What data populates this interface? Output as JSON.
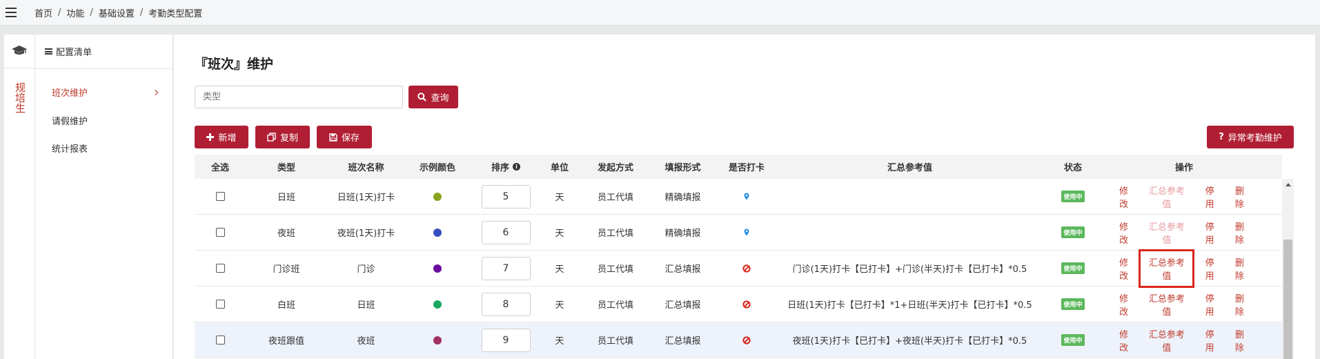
{
  "breadcrumb": [
    "首页",
    "功能",
    "基础设置",
    "考勤类型配置"
  ],
  "module": {
    "label": "规培生"
  },
  "menu": {
    "header": "配置清单",
    "items": [
      {
        "label": "班次维护",
        "active": true
      },
      {
        "label": "请假维护",
        "active": false
      },
      {
        "label": "统计报表",
        "active": false
      }
    ]
  },
  "page": {
    "title": "『班次』维护"
  },
  "search": {
    "placeholder": "类型",
    "button": "查询"
  },
  "toolbar": {
    "add": "新增",
    "copy": "复制",
    "save": "保存",
    "abnormal": "异常考勤维护"
  },
  "table": {
    "headers": {
      "select_all": "全选",
      "type": "类型",
      "shift_name": "班次名称",
      "color": "示例颜色",
      "order": "排序",
      "unit": "单位",
      "initiator": "发起方式",
      "form": "填报形式",
      "punch": "是否打卡",
      "summary": "汇总参考值",
      "status": "状态",
      "ops": "操作"
    },
    "rows": [
      {
        "type": "日班",
        "name": "日班(1天)打卡",
        "color": "#8aa31d",
        "order": "5",
        "unit": "天",
        "initiator": "员工代填",
        "form": "精确填报",
        "punch": "location",
        "summary": "",
        "status": "使用中",
        "ops": [
          "修改",
          "汇总参考值",
          "停用",
          "删除"
        ],
        "summary_enabled": false,
        "highlight": false,
        "boxed": false
      },
      {
        "type": "夜班",
        "name": "夜班(1天)打卡",
        "color": "#3a4fbf",
        "order": "6",
        "unit": "天",
        "initiator": "员工代填",
        "form": "精确填报",
        "punch": "location",
        "summary": "",
        "status": "使用中",
        "ops": [
          "修改",
          "汇总参考值",
          "停用",
          "删除"
        ],
        "summary_enabled": false,
        "highlight": false,
        "boxed": false
      },
      {
        "type": "门诊班",
        "name": "门诊",
        "color": "#6a0f9e",
        "order": "7",
        "unit": "天",
        "initiator": "员工代填",
        "form": "汇总填报",
        "punch": "no",
        "summary": "门诊(1天)打卡【已打卡】+门诊(半天)打卡【已打卡】*0.5",
        "status": "使用中",
        "ops": [
          "修改",
          "汇总参考值",
          "停用",
          "删除"
        ],
        "summary_enabled": true,
        "highlight": false,
        "boxed": true
      },
      {
        "type": "白班",
        "name": "日班",
        "color": "#1aa860",
        "order": "8",
        "unit": "天",
        "initiator": "员工代填",
        "form": "汇总填报",
        "punch": "no",
        "summary": "日班(1天)打卡【已打卡】*1+日班(半天)打卡【已打卡】*0.5",
        "status": "使用中",
        "ops": [
          "修改",
          "汇总参考值",
          "停用",
          "删除"
        ],
        "summary_enabled": true,
        "highlight": false,
        "boxed": false
      },
      {
        "type": "夜班跟值",
        "name": "夜班",
        "color": "#a0305f",
        "order": "9",
        "unit": "天",
        "initiator": "员工代填",
        "form": "汇总填报",
        "punch": "no",
        "summary": "夜班(1天)打卡【已打卡】+夜班(半天)打卡【已打卡】*0.5",
        "status": "使用中",
        "ops": [
          "修改",
          "汇总参考值",
          "停用",
          "删除"
        ],
        "summary_enabled": true,
        "highlight": true,
        "boxed": false
      }
    ]
  },
  "colors": {
    "primary": "#b01e33",
    "link": "#c0392b",
    "status_green": "#5cb85c"
  }
}
